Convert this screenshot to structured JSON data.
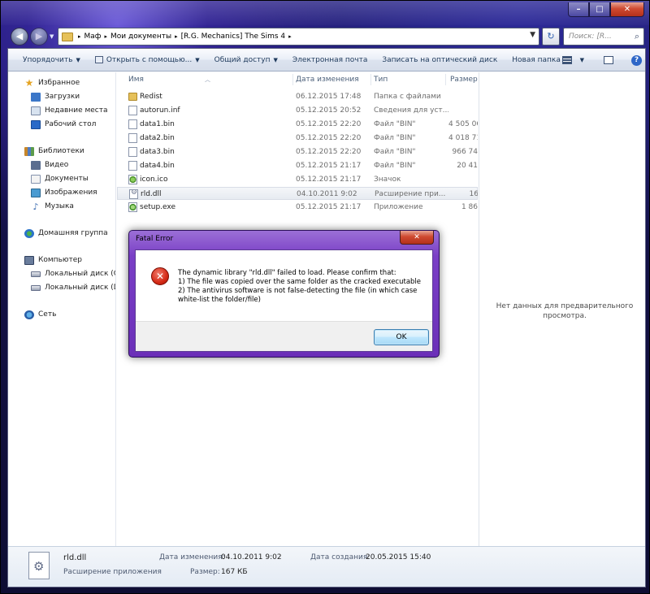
{
  "window": {
    "caption": {
      "minimize": "–",
      "maximize": "□",
      "close": "✕"
    }
  },
  "address_bar": {
    "crumbs": [
      "Маф",
      "Мои документы",
      "[R.G. Mechanics] The Sims 4"
    ],
    "search_placeholder": "Поиск: [R...",
    "refresh_glyph": "↻",
    "back_glyph": "◀",
    "forward_glyph": "▶",
    "dropdown_glyph": "▼",
    "separator_glyph": "▸"
  },
  "toolbar": {
    "organize": "Упорядочить",
    "open_with": "Открыть с помощью...",
    "share": "Общий доступ",
    "email": "Электронная почта",
    "burn": "Записать на оптический диск",
    "new_folder": "Новая папка",
    "arrow": "▼",
    "help": "?"
  },
  "nav": {
    "favorites": "Избранное",
    "downloads": "Загрузки",
    "recent": "Недавние места",
    "desktop": "Рабочий стол",
    "libraries": "Библиотеки",
    "video": "Видео",
    "documents": "Документы",
    "images": "Изображения",
    "music": "Музыка",
    "homegroup": "Домашняя группа",
    "computer": "Компьютер",
    "disk_c": "Локальный диск (C:)",
    "disk_d": "Локальный диск (D:)",
    "network": "Сеть"
  },
  "columns": {
    "name": "Имя",
    "date": "Дата изменения",
    "type": "Тип",
    "size": "Размер"
  },
  "files": [
    {
      "name": "Redist",
      "date": "06.12.2015 17:48",
      "type": "Папка с файлами",
      "size": "",
      "icon": "folder-icon"
    },
    {
      "name": "autorun.inf",
      "date": "05.12.2015 20:52",
      "type": "Сведения для уст...",
      "size": "",
      "icon": "document-icon"
    },
    {
      "name": "data1.bin",
      "date": "05.12.2015 22:20",
      "type": "Файл \"BIN\"",
      "size": "4 505 06",
      "icon": "document-icon"
    },
    {
      "name": "data2.bin",
      "date": "05.12.2015 22:20",
      "type": "Файл \"BIN\"",
      "size": "4 018 71",
      "icon": "document-icon"
    },
    {
      "name": "data3.bin",
      "date": "05.12.2015 22:20",
      "type": "Файл \"BIN\"",
      "size": "966 74",
      "icon": "document-icon"
    },
    {
      "name": "data4.bin",
      "date": "05.12.2015 21:17",
      "type": "Файл \"BIN\"",
      "size": "20 41",
      "icon": "document-icon"
    },
    {
      "name": "icon.ico",
      "date": "05.12.2015 21:17",
      "type": "Значок",
      "size": "",
      "icon": "ico-file-icon"
    },
    {
      "name": "rld.dll",
      "date": "04.10.2011 9:02",
      "type": "Расширение при...",
      "size": "16",
      "icon": "dll-file-icon"
    },
    {
      "name": "setup.exe",
      "date": "05.12.2015 21:17",
      "type": "Приложение",
      "size": "1 86",
      "icon": "exe-file-icon"
    }
  ],
  "preview": {
    "line1": "Нет данных для предварительного",
    "line2": "просмотра."
  },
  "details": {
    "name": "rld.dll",
    "kind": "Расширение приложения",
    "modified_label": "Дата изменения:",
    "modified_value": "04.10.2011 9:02",
    "created_label": "Дата создания:",
    "created_value": "20.05.2015 15:40",
    "size_label": "Размер:",
    "size_value": "167 КБ"
  },
  "dialog": {
    "title": "Fatal Error",
    "close": "✕",
    "icon": "error-icon",
    "icon_glyph": "✕",
    "lines": [
      "The dynamic library \"rld.dll\" failed to load. Please confirm that:",
      "1) The file was copied over the same folder as the cracked executable",
      "2) The antivirus software is not false-detecting the file (in which case",
      "white-list the folder/file)"
    ],
    "ok": "OK"
  },
  "colors": {
    "dialog_frame": "#7a3fc6",
    "close_button": "#cf4a31",
    "ok_border": "#3c7fb1",
    "selection": "#e7ebf1"
  }
}
